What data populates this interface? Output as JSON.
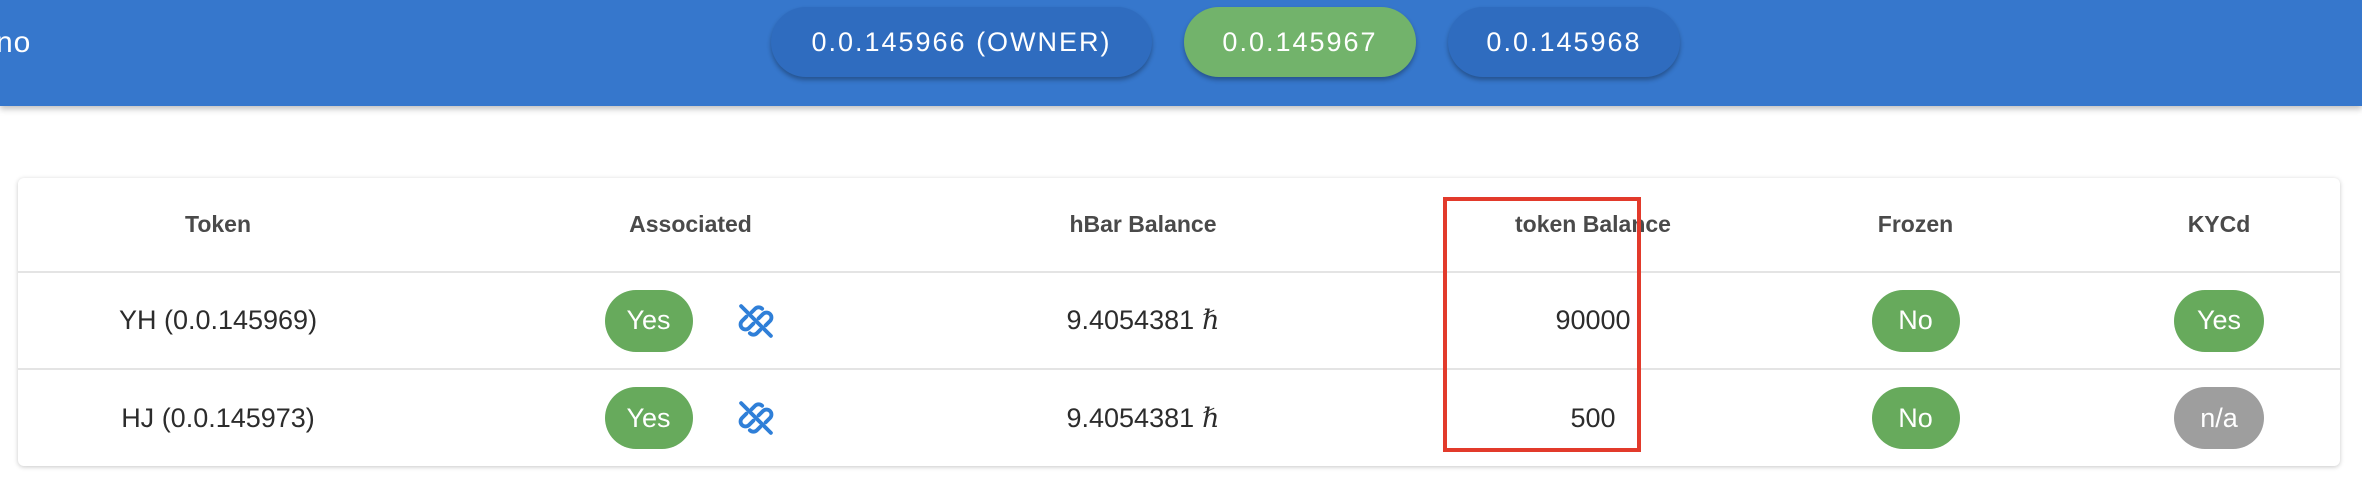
{
  "header": {
    "app_title": "no",
    "accounts": [
      {
        "label": "0.0.145966 (OWNER)",
        "active": false
      },
      {
        "label": "0.0.145967",
        "active": true
      },
      {
        "label": "0.0.145968",
        "active": false
      }
    ]
  },
  "table": {
    "columns": [
      "Token",
      "Associated",
      "hBar Balance",
      "token Balance",
      "Frozen",
      "KYCd"
    ],
    "rows": [
      {
        "token": "YH (0.0.145969)",
        "associated": "Yes",
        "hbar_balance": "9.4054381",
        "hbar_symbol": "ℏ",
        "token_balance": "90000",
        "frozen": "No",
        "kycd": "Yes"
      },
      {
        "token": "HJ (0.0.145973)",
        "associated": "Yes",
        "hbar_balance": "9.4054381",
        "hbar_symbol": "ℏ",
        "token_balance": "500",
        "frozen": "No",
        "kycd": "n/a"
      }
    ]
  },
  "icons": {
    "dissociate": "link-off-icon"
  },
  "colors": {
    "topbar": "#3677cc",
    "account_button": "#2f6cbf",
    "account_button_active": "#72b36b",
    "pill_green": "#67aa5c",
    "pill_gray": "#9e9e9e",
    "icon_blue": "#2f7fd8",
    "highlight": "#e23a2b"
  }
}
